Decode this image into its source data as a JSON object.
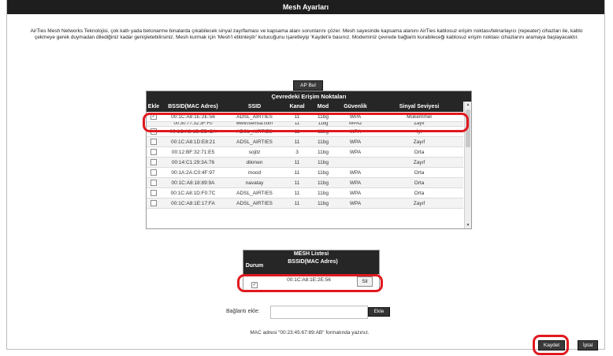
{
  "title": "Mesh Ayarları",
  "description": "AirTies Mesh Networks Teknolojisi, çok katlı yada betonarme binalarda çıkabilecek sinyal zayıflaması ve kapsama alanı sorunlarını çözer. Mesh sayesinde kapsama alanını AirTies kablosuz erişim noktası/tekrarlayıcı (repeater) cihazları ile, kablo çekmeye gerek duymadan dilediğiniz kadar genişletebilirsiniz. Mesh kurmak için 'Mesh'i etkinleştir' kutucuğunu işaretleyip 'Kaydet'e basınız. Modeminiz çevrede bağlantı kurabileceği kablosuz erişim noktası cihazlarını aramaya başlayacaktır.",
  "ap_button": "AP Bul",
  "ap_table": {
    "caption": "Çevredeki Erişim Noktaları",
    "columns": [
      "Ekle",
      "BSSID(MAC Adres)",
      "SSID",
      "Kanal",
      "Mod",
      "Güvenlik",
      "Sinyal Seviyesi"
    ],
    "rows": [
      {
        "checked": true,
        "bssid": "00:1C:A8:1E:2E:56",
        "ssid": "ADSL_AIRTIES",
        "kanal": "11",
        "mod": "11bg",
        "guvenlik": "WPA",
        "sinyal": "Mükemmel"
      },
      {
        "checked": false,
        "bssid": "00:30:77:32:3F:F0",
        "ssid": "www.isemsa.com",
        "kanal": "11",
        "mod": "11bg",
        "guvenlik": "WPA2",
        "sinyal": "Zayıf"
      },
      {
        "checked": false,
        "bssid": "00:1C:A8:1D:ED:CA",
        "ssid": "ADSL_AIRTIES",
        "kanal": "11",
        "mod": "11bg",
        "guvenlik": "WPA",
        "sinyal": "İyi"
      },
      {
        "checked": false,
        "bssid": "00:1C:A8:1D:E8:21",
        "ssid": "ADSL_AIRTIES",
        "kanal": "11",
        "mod": "11bg",
        "guvenlik": "WPA",
        "sinyal": "Zayıf"
      },
      {
        "checked": false,
        "bssid": "00:12:BF:32:71:E5",
        "ssid": "sojitz",
        "kanal": "3",
        "mod": "11bg",
        "guvenlik": "WPA",
        "sinyal": "Orta"
      },
      {
        "checked": false,
        "bssid": "00:14:C1:29:3A:76",
        "ssid": "dikmen",
        "kanal": "11",
        "mod": "11bg",
        "guvenlik": "",
        "sinyal": "Zayıf"
      },
      {
        "checked": false,
        "bssid": "00:1A:2A:C0:4F:97",
        "ssid": "mood",
        "kanal": "11",
        "mod": "11bg",
        "guvenlik": "WPA",
        "sinyal": "Orta"
      },
      {
        "checked": false,
        "bssid": "00:1C:A8:18:89:9A",
        "ssid": "navatay",
        "kanal": "11",
        "mod": "11bg",
        "guvenlik": "WPA",
        "sinyal": "Orta"
      },
      {
        "checked": false,
        "bssid": "00:1C:A8:1D:F0:7C",
        "ssid": "ADSL_AIRTIES",
        "kanal": "11",
        "mod": "11bg",
        "guvenlik": "WPA",
        "sinyal": "Orta"
      },
      {
        "checked": false,
        "bssid": "00:1C:A8:1E:17:FA",
        "ssid": "ADSL_AIRTIES",
        "kanal": "11",
        "mod": "11bg",
        "guvenlik": "WPA",
        "sinyal": "Zayıf"
      }
    ]
  },
  "mesh_list": {
    "caption": "MESH Listesi",
    "col_durum": "Durum",
    "col_bssid": "BSSID(MAC Adres)",
    "row": {
      "checked": true,
      "bssid": "00:1C:A8:1E:2E:56",
      "delete": "Sil"
    }
  },
  "add": {
    "label": "Bağlantı ekle:",
    "value": "",
    "button": "Ekle"
  },
  "hint": "MAC adresi \"00:23:45:67:89:AB\" formatında yazınız.",
  "save_button": "Kaydet",
  "cancel_button": "İptal",
  "colors": {
    "header": "#262626",
    "highlight": "#e0191f"
  },
  "scroll_icons": {
    "up": "▲",
    "down": "▼"
  }
}
